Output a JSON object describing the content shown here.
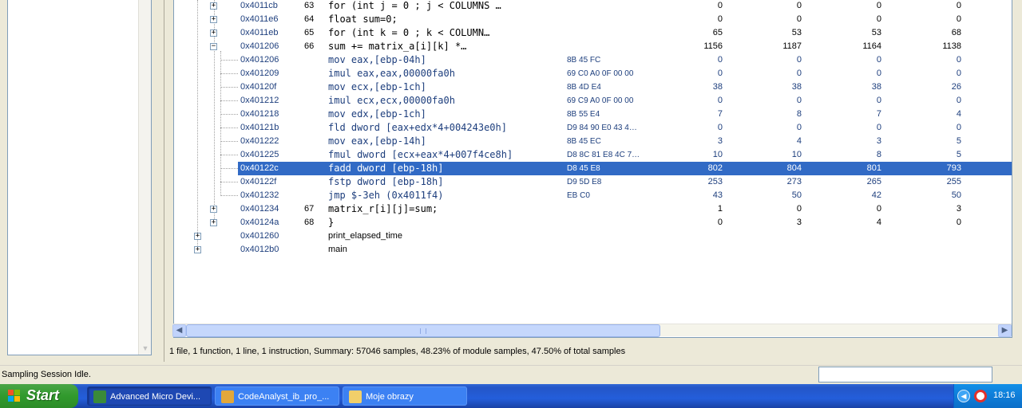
{
  "rows": [
    {
      "type": "src",
      "expander": "+",
      "addr": "0x4011cb",
      "line": "63",
      "src": "    for (int j = 0 ; j < COLUMNS …",
      "bytes": "",
      "c1": "0",
      "c2": "0",
      "c3": "0",
      "c4": "0"
    },
    {
      "type": "src",
      "expander": "+",
      "addr": "0x4011e6",
      "line": "64",
      "src": "      float sum=0;",
      "bytes": "",
      "c1": "0",
      "c2": "0",
      "c3": "0",
      "c4": "0"
    },
    {
      "type": "src",
      "expander": "+",
      "addr": "0x4011eb",
      "line": "65",
      "src": "      for (int k = 0 ; k < COLUMN…",
      "bytes": "",
      "c1": "65",
      "c2": "53",
      "c3": "53",
      "c4": "68"
    },
    {
      "type": "src",
      "expander": "−",
      "addr": "0x401206",
      "line": "66",
      "src": "        sum += matrix_a[i][k]  *…",
      "bytes": "",
      "c1": "1156",
      "c2": "1187",
      "c3": "1164",
      "c4": "1138"
    },
    {
      "type": "asm",
      "expander": "",
      "addr": "0x401206",
      "line": "",
      "src": "mov eax,[ebp-04h]",
      "bytes": "8B 45 FC",
      "c1": "0",
      "c2": "0",
      "c3": "0",
      "c4": "0"
    },
    {
      "type": "asm",
      "expander": "",
      "addr": "0x401209",
      "line": "",
      "src": "imul eax,eax,00000fa0h",
      "bytes": "69 C0 A0 0F 00 00",
      "c1": "0",
      "c2": "0",
      "c3": "0",
      "c4": "0"
    },
    {
      "type": "asm",
      "expander": "",
      "addr": "0x40120f",
      "line": "",
      "src": "mov ecx,[ebp-1ch]",
      "bytes": "8B 4D E4",
      "c1": "38",
      "c2": "38",
      "c3": "38",
      "c4": "26"
    },
    {
      "type": "asm",
      "expander": "",
      "addr": "0x401212",
      "line": "",
      "src": "imul ecx,ecx,00000fa0h",
      "bytes": "69 C9 A0 0F 00 00",
      "c1": "0",
      "c2": "0",
      "c3": "0",
      "c4": "0"
    },
    {
      "type": "asm",
      "expander": "",
      "addr": "0x401218",
      "line": "",
      "src": "mov edx,[ebp-1ch]",
      "bytes": "8B 55 E4",
      "c1": "7",
      "c2": "8",
      "c3": "7",
      "c4": "4"
    },
    {
      "type": "asm",
      "expander": "",
      "addr": "0x40121b",
      "line": "",
      "src": "fld dword [eax+edx*4+004243e0h]",
      "bytes": "D9 84 90 E0 43 4…",
      "c1": "0",
      "c2": "0",
      "c3": "0",
      "c4": "0"
    },
    {
      "type": "asm",
      "expander": "",
      "addr": "0x401222",
      "line": "",
      "src": "mov eax,[ebp-14h]",
      "bytes": "8B 45 EC",
      "c1": "3",
      "c2": "4",
      "c3": "3",
      "c4": "5"
    },
    {
      "type": "asm",
      "expander": "",
      "addr": "0x401225",
      "line": "",
      "src": "fmul dword [ecx+eax*4+007f4ce8h]",
      "bytes": "D8 8C 81 E8 4C 7…",
      "c1": "10",
      "c2": "10",
      "c3": "8",
      "c4": "5"
    },
    {
      "type": "asm",
      "selected": true,
      "expander": "",
      "addr": "0x40122c",
      "line": "",
      "src": "fadd dword [ebp-18h]",
      "bytes": "D8 45 E8",
      "c1": "802",
      "c2": "804",
      "c3": "801",
      "c4": "793"
    },
    {
      "type": "asm",
      "expander": "",
      "addr": "0x40122f",
      "line": "",
      "src": "fstp dword [ebp-18h]",
      "bytes": "D9 5D E8",
      "c1": "253",
      "c2": "273",
      "c3": "265",
      "c4": "255"
    },
    {
      "type": "asm",
      "expander": "",
      "addr": "0x401232",
      "line": "",
      "src": "jmp $-3eh (0x4011f4)",
      "bytes": "EB C0",
      "c1": "43",
      "c2": "50",
      "c3": "42",
      "c4": "50"
    },
    {
      "type": "src",
      "expander": "+",
      "addr": "0x401234",
      "line": "67",
      "src": "      matrix_r[i][j]=sum;",
      "bytes": "",
      "c1": "1",
      "c2": "0",
      "c3": "0",
      "c4": "3"
    },
    {
      "type": "src",
      "expander": "+",
      "addr": "0x40124a",
      "line": "68",
      "src": "  }",
      "bytes": "",
      "c1": "0",
      "c2": "3",
      "c3": "4",
      "c4": "0"
    },
    {
      "type": "func",
      "expander": "+",
      "addr": "0x401260",
      "line": "",
      "src": "print_elapsed_time",
      "bytes": "",
      "c1": "",
      "c2": "",
      "c3": "",
      "c4": ""
    },
    {
      "type": "func",
      "expander": "+",
      "addr": "0x4012b0",
      "line": "",
      "src": "main",
      "bytes": "",
      "c1": "",
      "c2": "",
      "c3": "",
      "c4": ""
    }
  ],
  "summary": "1 file, 1 function, 1 line, 1 instruction, Summary: 57046 samples, 48.23% of module samples, 47.50% of total samples",
  "status": {
    "text": "Sampling Session Idle.",
    "input_value": ""
  },
  "taskbar": {
    "start_label": "Start",
    "tasks": [
      {
        "label": "Advanced Micro Devi...",
        "active": true,
        "icon_color": "#3a8a3a"
      },
      {
        "label": "CodeAnalyst_ib_pro_...",
        "active": false,
        "icon_color": "#e2a73a"
      },
      {
        "label": "Moje obrazy",
        "active": false,
        "icon_color": "#f1cf6a"
      }
    ],
    "clock": "18:16"
  }
}
